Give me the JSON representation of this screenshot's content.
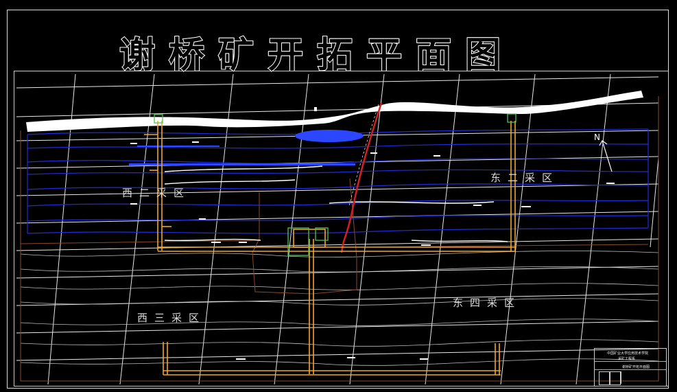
{
  "title": "谢桥矿开拓平面图",
  "zones": {
    "west_two": "西二采区",
    "east_two": "东二采区",
    "west_three": "西三采区",
    "east_four": "东四采区"
  },
  "north_marker": "N",
  "title_block": {
    "line1": "中国矿业大学应用技术学院",
    "line2": "采矿工程系",
    "line3": "谢桥矿开拓平面图"
  },
  "colors": {
    "background": "#000000",
    "roadway": "#f2a62a",
    "seam": "#1f2dd8",
    "grid": "#e8e8e8",
    "fault": "#d42020",
    "boundary": "#8a4a2a",
    "shaft": "#4fc44f"
  }
}
